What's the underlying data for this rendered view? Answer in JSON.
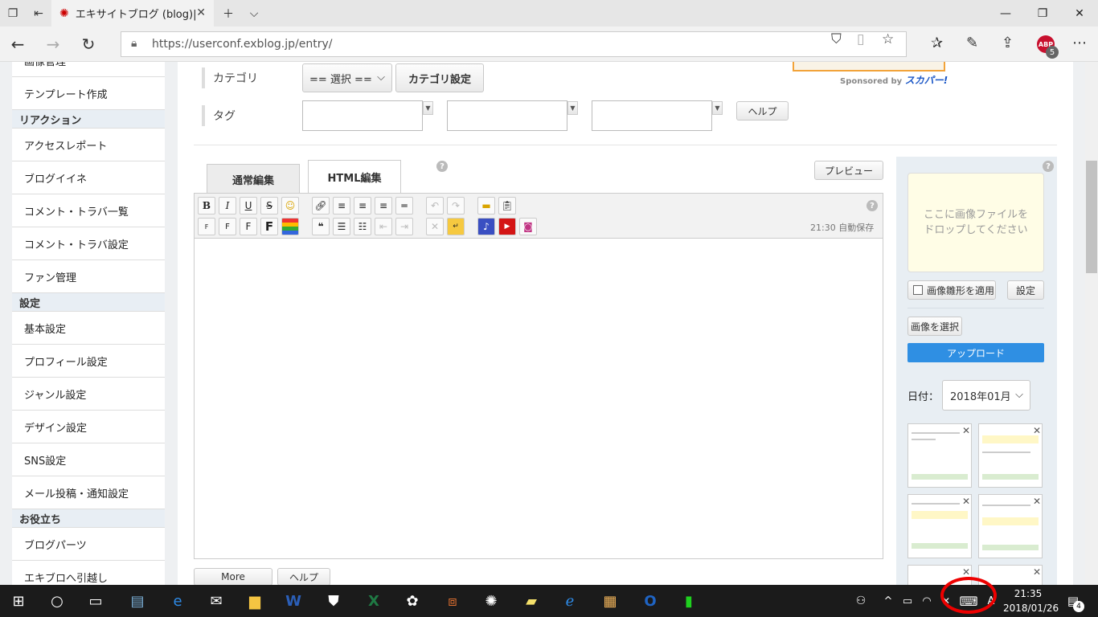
{
  "browser": {
    "tab_title": "エキサイトブログ (blog)|新規",
    "url": "https://userconf.exblog.jp/entry/",
    "abp_label": "ABP",
    "abp_count": "5"
  },
  "sidebar": {
    "items": [
      {
        "type": "item",
        "label": "画像管理"
      },
      {
        "type": "item",
        "label": "テンプレート作成"
      },
      {
        "type": "head",
        "label": "リアクション"
      },
      {
        "type": "item",
        "label": "アクセスレポート"
      },
      {
        "type": "item",
        "label": "ブログイイネ"
      },
      {
        "type": "item",
        "label": "コメント・トラバ一覧"
      },
      {
        "type": "item",
        "label": "コメント・トラバ設定"
      },
      {
        "type": "item",
        "label": "ファン管理"
      },
      {
        "type": "head",
        "label": "設定"
      },
      {
        "type": "item",
        "label": "基本設定"
      },
      {
        "type": "item",
        "label": "プロフィール設定"
      },
      {
        "type": "item",
        "label": "ジャンル設定"
      },
      {
        "type": "item",
        "label": "デザイン設定"
      },
      {
        "type": "item",
        "label": "SNS設定"
      },
      {
        "type": "item",
        "label": "メール投稿・通知設定"
      },
      {
        "type": "head",
        "label": "お役立ち"
      },
      {
        "type": "item",
        "label": "ブログパーツ"
      },
      {
        "type": "item",
        "label": "エキブロへ引越し"
      }
    ]
  },
  "form": {
    "category_label": "カテゴリ",
    "category_select": "== 選択 ==",
    "category_settings_button": "カテゴリ設定",
    "tag_label": "タグ",
    "tag_help_button": "ヘルプ",
    "sponsor_text": "Sponsored by",
    "sponsor_brand": "スカパー!"
  },
  "editor": {
    "tabs": [
      {
        "label": "通常編集",
        "active": false
      },
      {
        "label": "HTML編集",
        "active": true
      }
    ],
    "preview_button": "プレビュー",
    "autosave": "21:30 自動保存",
    "more_button": "More",
    "help_button": "ヘルプ"
  },
  "image_panel": {
    "dropzone": "ここに画像ファイルを\nドロップしてください",
    "shape_checkbox_label": "画像雛形を適用",
    "shape_checked": false,
    "settings_button": "設定",
    "select_button": "画像を選択",
    "upload_button": "アップロード",
    "date_label": "日付：",
    "date_value": "2018年01月"
  },
  "taskbar": {
    "time": "21:35",
    "date": "2018/01/26",
    "notification_count": "4"
  },
  "colors": {
    "accent": "#2f8fe3",
    "highlight": "#e00000"
  }
}
